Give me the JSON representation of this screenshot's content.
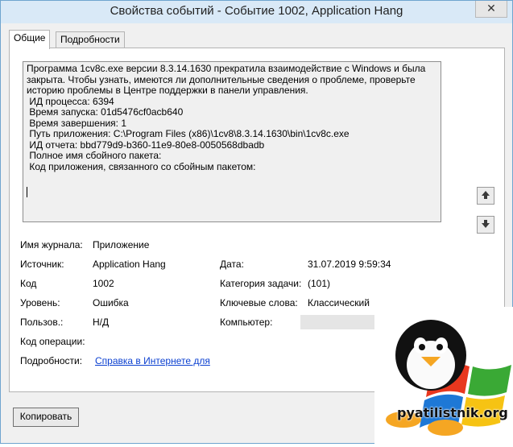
{
  "window": {
    "title": "Свойства событий - Событие 1002, Application Hang",
    "close_glyph": "✕"
  },
  "tabs": [
    {
      "label": "Общие",
      "active": true
    },
    {
      "label": "Подробности",
      "active": false
    }
  ],
  "description": {
    "lines": [
      "Программа 1cv8c.exe версии 8.3.14.1630 прекратила взаимодействие с Windows и была",
      "закрыта. Чтобы узнать, имеются ли дополнительные сведения о проблеме, проверьте",
      "историю проблемы в Центре поддержки в панели управления.",
      " ИД процесса: 6394",
      " Время запуска: 01d5476cf0acb640",
      " Время завершения: 1",
      " Путь приложения: C:\\Program Files (x86)\\1cv8\\8.3.14.1630\\bin\\1cv8c.exe",
      " ИД отчета: bbd779d9-b360-11e9-80e8-0050568dbadb",
      " Полное имя сбойного пакета:",
      " Код приложения, связанного со сбойным пакетом:"
    ]
  },
  "scroll": {
    "up_icon": "arrow-up-icon",
    "down_icon": "arrow-down-icon"
  },
  "fields": {
    "log_label": "Имя журнала:",
    "log_value": "Приложение",
    "source_label": "Источник:",
    "source_value": "Application Hang",
    "date_label": "Дата:",
    "date_value": "31.07.2019 9:59:34",
    "code_label": "Код",
    "code_value": "1002",
    "task_label": "Категория задачи:",
    "task_value": "(101)",
    "level_label": "Уровень:",
    "level_value": "Ошибка",
    "keywords_label": "Ключевые слова:",
    "keywords_value": "Классический",
    "user_label": "Пользов.:",
    "user_value": "Н/Д",
    "computer_label": "Компьютер:",
    "opcode_label": "Код операции:",
    "details_label": "Подробности:",
    "details_link": "Справка в Интернете для"
  },
  "copy_button": "Копировать",
  "watermark": {
    "text": "pyatilistnik.org"
  },
  "colors": {
    "link": "#0a3fd0",
    "titlebar": "#d9e9f7",
    "border": "#6fa4cf"
  }
}
